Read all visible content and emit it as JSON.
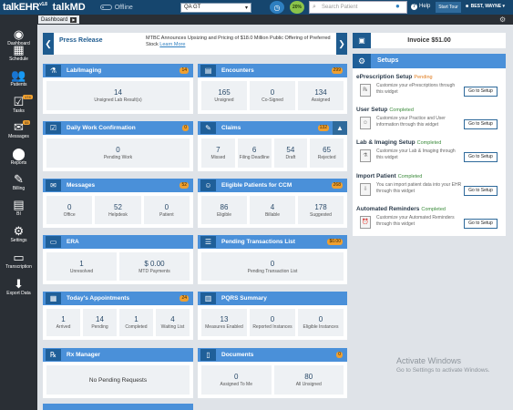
{
  "topbar": {
    "logo_primary": "talkEHR",
    "logo_version": "v1.8",
    "logo_secondary": "talkMD",
    "offline_label": "Offline",
    "practice_select": "QA GT",
    "percent_badge": "20%",
    "search_placeholder": "Search Patient",
    "help_label": "Help",
    "start_tour_label": "Start Tour",
    "user_name": "BEST, WAYNE"
  },
  "subbar": {
    "tab_label": "Dashboard"
  },
  "sidebar": {
    "items": [
      {
        "label": "Dashboard",
        "icon": "◉"
      },
      {
        "label": "Schedule",
        "icon": "▦"
      },
      {
        "label": "Patients",
        "icon": "👥"
      },
      {
        "label": "Tasks",
        "icon": "☑",
        "badge": "174"
      },
      {
        "label": "Messages",
        "icon": "✉",
        "badge": "55"
      },
      {
        "label": "Reports",
        "icon": "⬤"
      },
      {
        "label": "Billing",
        "icon": "✎"
      },
      {
        "label": "BI",
        "icon": "▤"
      },
      {
        "label": "Settings",
        "icon": "⚙"
      },
      {
        "label": "Transcription",
        "icon": "▭"
      },
      {
        "label": "Export Data",
        "icon": "⬇"
      }
    ]
  },
  "news": {
    "heading": "Press Release",
    "text": "MTBC Announces Upsizing and Pricing of $18.0 Million Public Offering of Preferred Stock",
    "learn_more": "Learn More"
  },
  "widgets": {
    "lab": {
      "title": "Lab/Imaging",
      "badge": "14",
      "stats": [
        {
          "n": "14",
          "l": "Unsigned Lab Result(s)"
        }
      ]
    },
    "encounters": {
      "title": "Encounters",
      "badge": "299",
      "stats": [
        {
          "n": "165",
          "l": "Unsigned"
        },
        {
          "n": "0",
          "l": "Co-Signed"
        },
        {
          "n": "134",
          "l": "Assigned"
        }
      ]
    },
    "dwc": {
      "title": "Daily Work Confirmation",
      "badge": "0",
      "stats": [
        {
          "n": "0",
          "l": "Pending Work"
        }
      ]
    },
    "claims": {
      "title": "Claims",
      "badge": "132",
      "stats": [
        {
          "n": "7",
          "l": "Missed"
        },
        {
          "n": "6",
          "l": "Filing Deadline"
        },
        {
          "n": "54",
          "l": "Draft"
        },
        {
          "n": "65",
          "l": "Rejected"
        }
      ]
    },
    "messages": {
      "title": "Messages",
      "badge": "52",
      "stats": [
        {
          "n": "0",
          "l": "Office"
        },
        {
          "n": "52",
          "l": "Helpdesk"
        },
        {
          "n": "0",
          "l": "Patient"
        }
      ]
    },
    "ccm": {
      "title": "Eligible Patients for CCM",
      "badge": "268",
      "stats": [
        {
          "n": "86",
          "l": "Eligible"
        },
        {
          "n": "4",
          "l": "Billable"
        },
        {
          "n": "178",
          "l": "Suggested"
        }
      ]
    },
    "era": {
      "title": "ERA",
      "stats": [
        {
          "n": "1",
          "l": "Unresolved"
        },
        {
          "n": "$ 0.00",
          "l": "MTD Payments"
        }
      ]
    },
    "ptl": {
      "title": "Pending Transactions List",
      "badge": "$0.00",
      "stats": [
        {
          "n": "0",
          "l": "Pending Transaction List"
        }
      ]
    },
    "appts": {
      "title": "Today's Appointments",
      "badge": "24",
      "stats": [
        {
          "n": "1",
          "l": "Arrived"
        },
        {
          "n": "14",
          "l": "Pending"
        },
        {
          "n": "1",
          "l": "Completed"
        },
        {
          "n": "4",
          "l": "Waiting List"
        }
      ]
    },
    "pqrs": {
      "title": "PQRS Summary",
      "stats": [
        {
          "n": "13",
          "l": "Measures Enabled"
        },
        {
          "n": "0",
          "l": "Reported Instances"
        },
        {
          "n": "0",
          "l": "Eligible Instances"
        }
      ]
    },
    "rx": {
      "title": "Rx Manager",
      "text": "No Pending Requests"
    },
    "docs": {
      "title": "Documents",
      "badge": "0",
      "stats": [
        {
          "n": "0",
          "l": "Assigned To Me"
        },
        {
          "n": "80",
          "l": "All Unsigned"
        }
      ]
    }
  },
  "invoice": {
    "label": "Invoice $51.00"
  },
  "setups": {
    "title": "Setups",
    "rows": [
      {
        "title": "ePrescription Setup",
        "status": "Pending",
        "desc": "Customize your ePrescriptions through this widget",
        "btn": "Go to Setup"
      },
      {
        "title": "User Setup",
        "status": "Completed",
        "desc": "Customize your Practice and User information through this widget",
        "btn": "Go to Setup"
      },
      {
        "title": "Lab & Imaging Setup",
        "status": "Completed",
        "desc": "Customize your Lab & Imaging through this widget",
        "btn": "Go to Setup"
      },
      {
        "title": "Import Patient",
        "status": "Completed",
        "desc": "You can import patient data into your EHR through this widget",
        "btn": "Go to Setup"
      },
      {
        "title": "Automated Reminders",
        "status": "Completed",
        "desc": "Customize your Automated Reminders through this widget",
        "btn": "Go to Setup"
      }
    ]
  },
  "watermark": {
    "line1": "Activate Windows",
    "line2": "Go to Settings to activate Windows."
  }
}
